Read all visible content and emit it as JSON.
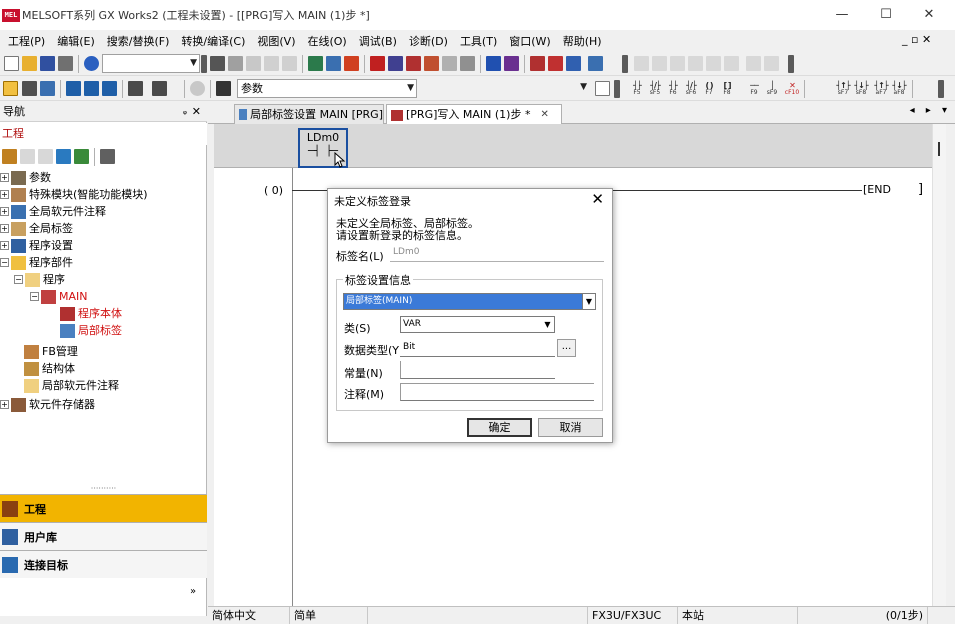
{
  "window": {
    "title": "MELSOFT系列 GX Works2 (工程未设置) - [[PRG]写入 MAIN (1)步 *]",
    "icon_text": "MEL",
    "minimize": "—",
    "maximize": "☐",
    "close": "✕"
  },
  "menu": {
    "items": [
      "工程(P)",
      "编辑(E)",
      "搜索/替换(F)",
      "转换/编译(C)",
      "视图(V)",
      "在线(O)",
      "调试(B)",
      "诊断(D)",
      "工具(T)",
      "窗口(W)",
      "帮助(H)"
    ],
    "mdi_restore": "_ ▫ ✕"
  },
  "toolbar": {
    "combo1_value": "",
    "combo2_value": "参数",
    "combo3_value": "",
    "fkeys": [
      {
        "top": "",
        "bottom": "F5"
      },
      {
        "top": "",
        "bottom": "sF5"
      },
      {
        "top": "",
        "bottom": "F6"
      },
      {
        "top": "",
        "bottom": "sF6"
      },
      {
        "top": "",
        "bottom": "F7"
      },
      {
        "top": "",
        "bottom": "F8"
      },
      {
        "top": "",
        "bottom": "F9"
      },
      {
        "top": "",
        "bottom": "sF9"
      },
      {
        "top": "",
        "bottom": "cF10"
      },
      {
        "top": "",
        "bottom": "sF7"
      },
      {
        "top": "",
        "bottom": "sF8"
      },
      {
        "top": "",
        "bottom": "aF7"
      },
      {
        "top": "",
        "bottom": "aF8"
      }
    ]
  },
  "nav": {
    "header": "导航",
    "pin": "ᵩ",
    "close": "✕",
    "section": "工程",
    "tree": [
      {
        "label": "参数"
      },
      {
        "label": "特殊模块(智能功能模块)"
      },
      {
        "label": "全局软元件注释"
      },
      {
        "label": "全局标签"
      },
      {
        "label": "程序设置"
      },
      {
        "label": "程序部件"
      },
      {
        "label": "程序"
      },
      {
        "label": "MAIN"
      },
      {
        "label": "程序本体"
      },
      {
        "label": "局部标签"
      },
      {
        "label": "FB管理"
      },
      {
        "label": "结构体"
      },
      {
        "label": "局部软元件注释"
      },
      {
        "label": "软元件存储器"
      }
    ],
    "splitter": "··········",
    "tabs": [
      {
        "label": "工程"
      },
      {
        "label": "用户库"
      },
      {
        "label": "连接目标"
      }
    ],
    "more": "»"
  },
  "editor": {
    "tabs": [
      {
        "label": "局部标签设置 MAIN [PRG]",
        "active": false
      },
      {
        "label": "[PRG]写入 MAIN (1)步 *",
        "active": true,
        "close": "✕"
      }
    ],
    "tab_scroll": "◂ ▸ ▾",
    "contact_label": "LDm0",
    "contact_symbol": "─┤ ├─",
    "step_no": "(   0)",
    "end_instr": "[END",
    "right_rail": "]"
  },
  "dialog": {
    "title": "未定义标签登录",
    "close": "✕",
    "msg1": "未定义全局标签、局部标签。",
    "msg2": "请设置新登录的标签信息。",
    "label_name_label": "标签名(L)",
    "label_name_value": "LDm0",
    "group_title": "标签设置信息",
    "scope_value": "局部标签(MAIN)",
    "class_label": "类(S)",
    "class_value": "VAR",
    "dtype_label": "数据类型(Y)",
    "dtype_value": "Bit",
    "dtype_btn": "...",
    "const_label": "常量(N)",
    "comment_label": "注释(M)",
    "ok": "确定",
    "cancel": "取消"
  },
  "status": {
    "language": "简体中文",
    "mode": "简单",
    "plc": "FX3U/FX3UC",
    "station": "本站",
    "steps": "(0/1步)"
  },
  "colors": {
    "accent": "#f2b400",
    "selection": "#3b7ad8",
    "contact_border": "#1a4fa0"
  }
}
